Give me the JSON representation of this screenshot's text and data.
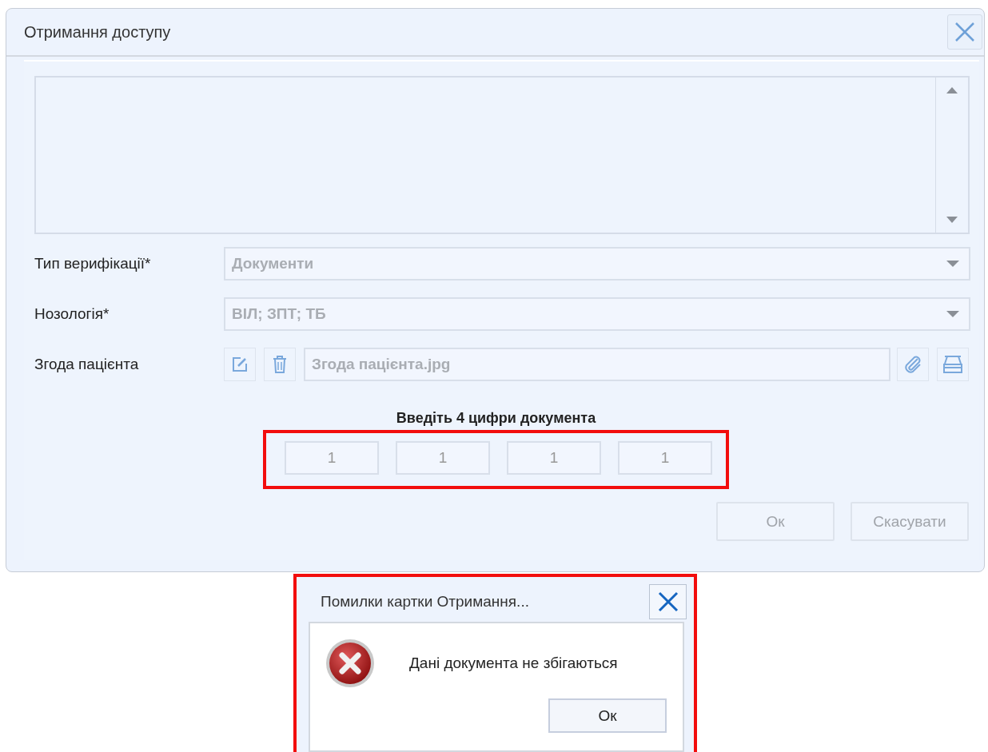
{
  "window": {
    "title": "Отримання доступу"
  },
  "fields": [
    {
      "kind": "select",
      "label": "Тип верифікації*",
      "value": "Документи",
      "disabled": true
    },
    {
      "kind": "select",
      "label": "Нозологія*",
      "value": "ВІЛ; ЗПТ; ТБ",
      "disabled": true
    },
    {
      "kind": "file",
      "label": "Згода пацієнта",
      "value": "Згода пацієнта.jpg",
      "disabled": true
    }
  ],
  "document_check": {
    "heading": "Введіть 4 цифри документа",
    "highlighted": true,
    "digits": [
      "1",
      "1",
      "1",
      "1"
    ]
  },
  "buttons": [
    {
      "label": "Ок",
      "disabled": true
    },
    {
      "label": "Скасувати",
      "disabled": true
    }
  ],
  "error_dialog": {
    "title": "Помилки картки Отримання...",
    "message": "Дані документа не збігаються",
    "button": "Ок",
    "highlighted": true
  }
}
